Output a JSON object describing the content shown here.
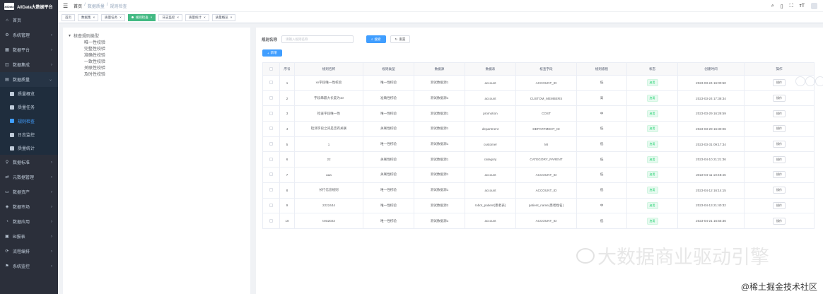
{
  "app": {
    "logo_text": "AllData大数据平台",
    "logo_mark": "allData"
  },
  "sidebar": {
    "items": [
      {
        "icon": "home-icon",
        "label": "首页",
        "arrow": ""
      },
      {
        "icon": "gear-icon",
        "label": "系统管理",
        "arrow": "›"
      },
      {
        "icon": "grid-icon",
        "label": "数据平台",
        "arrow": "›"
      },
      {
        "icon": "box-icon",
        "label": "数据集成",
        "arrow": "›"
      },
      {
        "icon": "chart-icon",
        "label": "数据质量",
        "arrow": "⌄"
      }
    ],
    "subitems": [
      {
        "label": "质量概览"
      },
      {
        "label": "质量任务"
      },
      {
        "label": "规则检查"
      },
      {
        "label": "日志监控"
      },
      {
        "label": "质量统计"
      }
    ],
    "items_after": [
      {
        "icon": "filter-icon",
        "label": "数据标准",
        "arrow": "›"
      },
      {
        "icon": "flow-icon",
        "label": "元数据管理",
        "arrow": "›"
      },
      {
        "icon": "folder-icon",
        "label": "数据资产",
        "arrow": "›"
      },
      {
        "icon": "market-icon",
        "label": "数据市场",
        "arrow": "›"
      },
      {
        "icon": "visual-icon",
        "label": "数据应用",
        "arrow": "›"
      },
      {
        "icon": "monitor-icon",
        "label": "BI报表",
        "arrow": "›"
      },
      {
        "icon": "process-icon",
        "label": "流程编排",
        "arrow": "›"
      },
      {
        "icon": "alert-icon",
        "label": "系统监控",
        "arrow": "›"
      }
    ]
  },
  "header": {
    "breadcrumb": [
      "首页",
      "/",
      "数据质量",
      "/",
      "规则检查"
    ]
  },
  "tags": [
    {
      "label": "首页",
      "active": false,
      "close": ""
    },
    {
      "label": "数据集",
      "active": false,
      "close": "×"
    },
    {
      "label": "质量任务",
      "active": false,
      "close": "×"
    },
    {
      "label": "规则检查",
      "active": true,
      "close": "×"
    },
    {
      "label": "日志监控",
      "active": false,
      "close": "×"
    },
    {
      "label": "质量统计",
      "active": false,
      "close": "×"
    },
    {
      "label": "质量概览",
      "active": false,
      "close": "×"
    }
  ],
  "tree": {
    "root": "核查规则类型",
    "nodes": [
      "唯一性校验",
      "完整性校验",
      "准确性校验",
      "一致性校验",
      "关联性校验",
      "及时性校验"
    ]
  },
  "search": {
    "label": "规则名称",
    "placeholder": "请输入规则名称",
    "search_btn": "搜索",
    "reset_btn": "重置",
    "add_btn": "新增"
  },
  "table": {
    "headers": [
      "",
      "序号",
      "规则名称",
      "规则类型",
      "数据源",
      "数据表",
      "核查字段",
      "规则级别",
      "状态",
      "创建时间",
      "操作"
    ],
    "rows": [
      [
        "",
        "1",
        "xx字段唯一性校验",
        "唯一性校验",
        "测试数据源1",
        "account",
        "ACCOUNT_ID",
        "低",
        "启用",
        "2023-03-24 16:00:50",
        "操作"
      ],
      [
        "",
        "2",
        "字段串最大长度为10",
        "准确性校验",
        "测试数据源1",
        "account",
        "CUSTOM_MEMBERS",
        "高",
        "启用",
        "2023-03-24 17:38:34",
        "操作"
      ],
      [
        "",
        "3",
        "检查字段唯一性",
        "唯一性校验",
        "测试数据源1",
        "promotion",
        "COST",
        "中",
        "启用",
        "2023-03-29 16:28:59",
        "操作"
      ],
      [
        "",
        "4",
        "检测字段之间是否有关联",
        "关联性校验",
        "测试数据源1",
        "department",
        "DEPARTMENT_ID",
        "低",
        "启用",
        "2023-03-29 16:30:06",
        "操作"
      ],
      [
        "",
        "5",
        "1",
        "唯一性校验",
        "测试数据源1",
        "customer",
        "MI",
        "低",
        "启用",
        "2023-03-31 09:17:34",
        "操作"
      ],
      [
        "",
        "6",
        "22",
        "关联性校验",
        "测试数据源1",
        "category",
        "CATEGORY_PARENT",
        "低",
        "启用",
        "2023-04-10 21:21:36",
        "操作"
      ],
      [
        "",
        "7",
        "aaa",
        "关联性校验",
        "测试数据源1",
        "account",
        "ACCOUNT_ID",
        "低",
        "启用",
        "2023-04-11 10:48:46",
        "操作"
      ],
      [
        "",
        "8",
        "长行信息规则",
        "唯一性校验",
        "测试数据源1",
        "account",
        "ACCOUNT_ID",
        "低",
        "启用",
        "2023-04-12 16:14:15",
        "操作"
      ],
      [
        "",
        "9",
        "2222444",
        "唯一性校验",
        "测试数据源2",
        "robot_patient(患者表)",
        "patient_name(患者姓名)",
        "中",
        "启用",
        "2023-04-13 21:40:32",
        "操作"
      ],
      [
        "",
        "10",
        "test2023",
        "唯一性校验",
        "测试数据源1",
        "account",
        "ACCOUNT_ID",
        "低",
        "启用",
        "2023-04-21 16:55:36",
        "操作"
      ]
    ]
  },
  "watermark": {
    "text": "大数据商业驱动引擎"
  },
  "footer": {
    "text": "@稀土掘金技术社区"
  }
}
